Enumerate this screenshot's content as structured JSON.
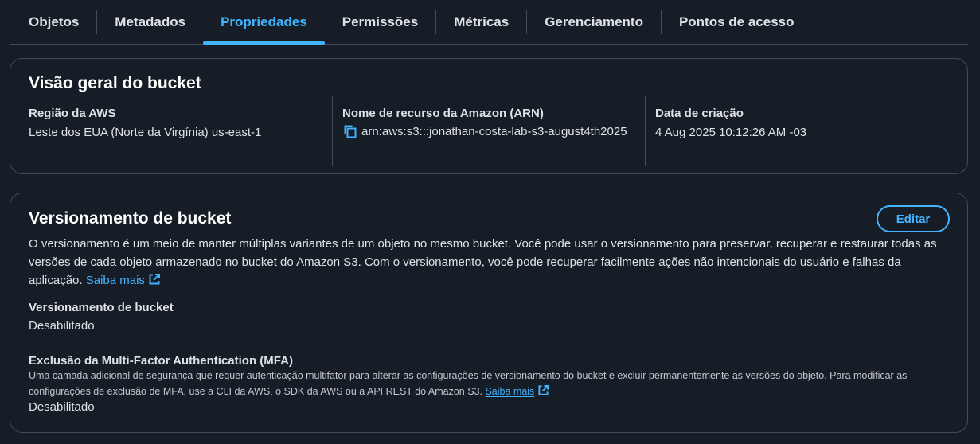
{
  "tabs": [
    {
      "label": "Objetos"
    },
    {
      "label": "Metadados"
    },
    {
      "label": "Propriedades"
    },
    {
      "label": "Permissões"
    },
    {
      "label": "Métricas"
    },
    {
      "label": "Gerenciamento"
    },
    {
      "label": "Pontos de acesso"
    }
  ],
  "active_tab": "Propriedades",
  "overview": {
    "title": "Visão geral do bucket",
    "region_label": "Região da AWS",
    "region_value": "Leste dos EUA (Norte da Virgínia) us-east-1",
    "arn_label": "Nome de recurso da Amazon (ARN)",
    "arn_value": "arn:aws:s3:::jonathan-costa-lab-s3-august4th2025",
    "created_label": "Data de criação",
    "created_value": "4 Aug 2025 10:12:26 AM -03"
  },
  "versioning": {
    "title": "Versionamento de bucket",
    "edit_label": "Editar",
    "description": "O versionamento é um meio de manter múltiplas variantes de um objeto no mesmo bucket. Você pode usar o versionamento para preservar, recuperar e restaurar todas as versões de cada objeto armazenado no bucket do Amazon S3. Com o versionamento, você pode recuperar facilmente ações não intencionais do usuário e falhas da aplicação.",
    "learn_more": "Saiba mais",
    "status_label": "Versionamento de bucket",
    "status_value": "Desabilitado",
    "mfa_label": "Exclusão da Multi-Factor Authentication (MFA)",
    "mfa_help": "Uma camada adicional de segurança que requer autenticação multifator para alterar as configurações de versionamento do bucket e excluir permanentemente as versões do objeto. Para modificar as configurações de exclusão de MFA, use a CLI da AWS, o SDK da AWS ou a API REST do Amazon S3.",
    "mfa_learn_more": "Saiba mais",
    "mfa_value": "Desabilitado"
  },
  "colors": {
    "accent": "#42b4ff",
    "background": "#161d26",
    "border": "#414d5c"
  },
  "icons": {
    "copy": "copy-icon",
    "external_link": "external-link-icon"
  }
}
